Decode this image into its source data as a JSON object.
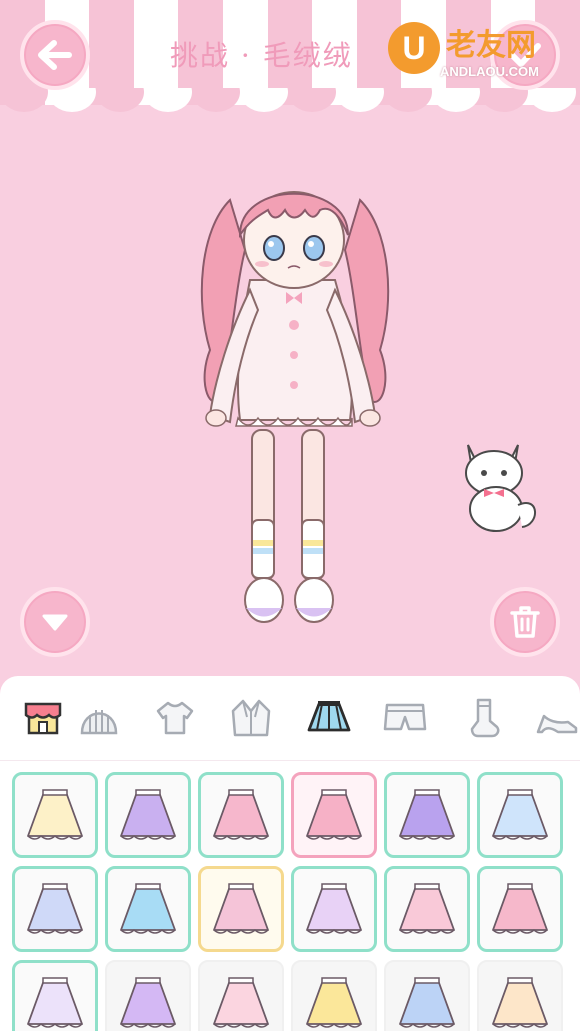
{
  "header": {
    "back_icon": "arrow-left-icon",
    "confirm_icon": "check-icon",
    "title": "挑战 · 毛绒绒"
  },
  "watermark": {
    "logo_letter": "U",
    "name": "老友网",
    "url": "ANDLAOU.COM"
  },
  "stage": {
    "down_icon": "triangle-down-icon",
    "trash_icon": "trash-icon"
  },
  "categories": [
    {
      "name": "shop",
      "icon": "shop-icon"
    },
    {
      "name": "hat",
      "icon": "hat-icon"
    },
    {
      "name": "shirt",
      "icon": "shirt-icon"
    },
    {
      "name": "jacket",
      "icon": "jacket-icon"
    },
    {
      "name": "skirt",
      "icon": "skirt-icon",
      "active": true
    },
    {
      "name": "shorts",
      "icon": "shorts-icon"
    },
    {
      "name": "socks",
      "icon": "sock-icon"
    },
    {
      "name": "shoes",
      "icon": "high-heel-icon"
    }
  ],
  "items": [
    {
      "id": "skirt-1",
      "color": "#fdf1c8",
      "state": "owned"
    },
    {
      "id": "skirt-2",
      "color": "#c9b0f0",
      "state": "owned"
    },
    {
      "id": "skirt-3",
      "color": "#f6b7cc",
      "state": "owned"
    },
    {
      "id": "skirt-4",
      "color": "#f6b1c6",
      "state": "selected"
    },
    {
      "id": "skirt-5",
      "color": "#b9a2ee",
      "state": "owned"
    },
    {
      "id": "skirt-6",
      "color": "#cfe4fb",
      "state": "owned"
    },
    {
      "id": "skirt-7",
      "color": "#cfd9f8",
      "state": "owned"
    },
    {
      "id": "skirt-8",
      "color": "#a8dcf5",
      "state": "owned"
    },
    {
      "id": "skirt-9",
      "color": "#f5c4d8",
      "state": "gold"
    },
    {
      "id": "skirt-10",
      "color": "#e8d2f6",
      "state": "owned"
    },
    {
      "id": "skirt-11",
      "color": "#f9c9d8",
      "state": "owned"
    },
    {
      "id": "skirt-12",
      "color": "#f6b8cb",
      "state": "owned"
    },
    {
      "id": "skirt-13",
      "color": "#ece2fa",
      "state": "owned"
    },
    {
      "id": "skirt-14",
      "color": "#d4b8f4",
      "state": "locked"
    },
    {
      "id": "skirt-15",
      "color": "#fbd5e0",
      "state": "locked"
    },
    {
      "id": "skirt-16",
      "color": "#fbe79a",
      "state": "locked"
    },
    {
      "id": "skirt-17",
      "color": "#bcd3f6",
      "state": "locked"
    },
    {
      "id": "skirt-18",
      "color": "#fde6c9",
      "state": "locked"
    }
  ],
  "colors": {
    "background": "#f9cfe0",
    "button": "#f7b6cc",
    "owned_border": "#8fe0c9",
    "selected_border": "#f4a3bd"
  }
}
